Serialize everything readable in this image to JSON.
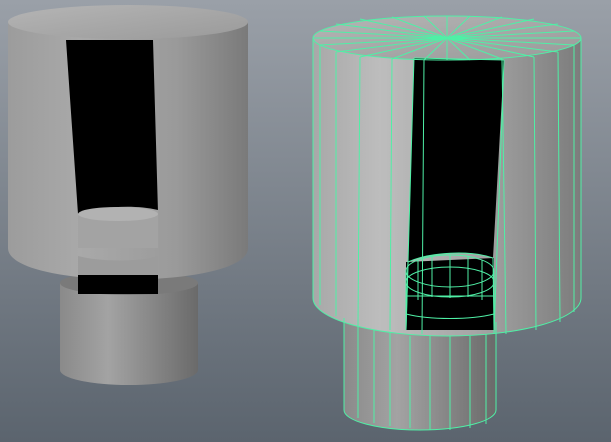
{
  "viewport": {
    "background_top": "#9aa0a8",
    "background_bottom": "#5b646e"
  },
  "objects": [
    {
      "name": "shaded-cup",
      "selected": false
    },
    {
      "name": "wireframe-cup",
      "selected": true
    }
  ],
  "colors": {
    "selection_wire": "#4ff0a6",
    "hole": "#000000",
    "hole_shading": "#1a1a1a",
    "cylinder_light": "#b8b8b8",
    "cylinder_mid": "#8e8e8e",
    "cylinder_dark": "#5e5e5e",
    "ui_panel": "#4a4c50"
  }
}
